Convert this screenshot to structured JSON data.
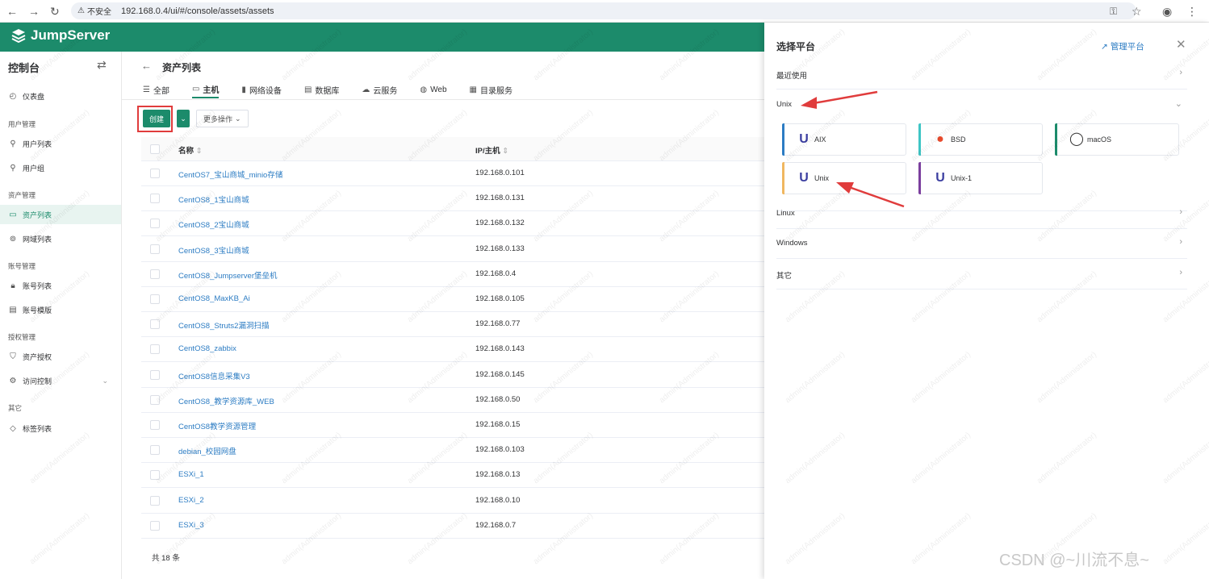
{
  "browser": {
    "insecure_label": "不安全",
    "url": "192.168.0.4/ui/#/console/assets/assets"
  },
  "app": {
    "name": "JumpServer"
  },
  "sidebar": {
    "title": "控制台",
    "groups": {
      "users": "用户管理",
      "assets": "资产管理",
      "accounts": "账号管理",
      "perms": "授权管理",
      "other": "其它"
    },
    "items": {
      "dashboard": "仪表盘",
      "user_list": "用户列表",
      "user_group": "用户组",
      "asset_list": "资产列表",
      "domain_list": "网域列表",
      "account_list": "账号列表",
      "account_template": "账号模版",
      "asset_perm": "资产授权",
      "access_control": "访问控制",
      "label_list": "标签列表"
    }
  },
  "main": {
    "title": "资产列表",
    "tabs": [
      "全部",
      "主机",
      "网络设备",
      "数据库",
      "云服务",
      "Web",
      "目录服务"
    ],
    "create_label": "创建",
    "more_ops_label": "更多操作",
    "columns": {
      "name": "名称",
      "ip": "IP/主机"
    },
    "rows": [
      {
        "name": "CentOS7_宝山商城_minio存储",
        "ip": "192.168.0.101"
      },
      {
        "name": "CentOS8_1宝山商城",
        "ip": "192.168.0.131"
      },
      {
        "name": "CentOS8_2宝山商城",
        "ip": "192.168.0.132"
      },
      {
        "name": "CentOS8_3宝山商城",
        "ip": "192.168.0.133"
      },
      {
        "name": "CentOS8_Jumpserver堡垒机",
        "ip": "192.168.0.4"
      },
      {
        "name": "CentOS8_MaxKB_Ai",
        "ip": "192.168.0.105"
      },
      {
        "name": "CentOS8_Struts2漏洞扫描",
        "ip": "192.168.0.77"
      },
      {
        "name": "CentOS8_zabbix",
        "ip": "192.168.0.143"
      },
      {
        "name": "CentOS8信息采集V3",
        "ip": "192.168.0.145"
      },
      {
        "name": "CentOS8_教学资源库_WEB",
        "ip": "192.168.0.50"
      },
      {
        "name": "CentOS8教学资源管理",
        "ip": "192.168.0.15"
      },
      {
        "name": "debian_校园网盘",
        "ip": "192.168.0.103"
      },
      {
        "name": "ESXi_1",
        "ip": "192.168.0.13"
      },
      {
        "name": "ESXi_2",
        "ip": "192.168.0.10"
      },
      {
        "name": "ESXi_3",
        "ip": "192.168.0.7"
      }
    ],
    "total": "共 18 条"
  },
  "drawer": {
    "title": "选择平台",
    "manage_label": "管理平台",
    "sections": {
      "recent": "最近使用",
      "unix": "Unix",
      "linux": "Linux",
      "windows": "Windows",
      "other": "其它"
    },
    "platforms": [
      {
        "name": "AIX",
        "color": "#2c7cc3",
        "icon": "unix-u-icon"
      },
      {
        "name": "BSD",
        "color": "#3fc5c5",
        "icon": "bsd-daemon-icon"
      },
      {
        "name": "macOS",
        "color": "#1c8b6b",
        "icon": "apple-icon"
      },
      {
        "name": "Unix",
        "color": "#f0b760",
        "icon": "unix-u-icon"
      },
      {
        "name": "Unix-1",
        "color": "#7b3f9e",
        "icon": "unix-u-icon"
      }
    ]
  },
  "watermark": {
    "text": "admin(Administrator)"
  },
  "credit": {
    "text": "CSDN @~川流不息~"
  },
  "colors": {
    "brand": "#1c8b6b",
    "link": "#2c7cc3",
    "annotation": "#e03c3c"
  }
}
